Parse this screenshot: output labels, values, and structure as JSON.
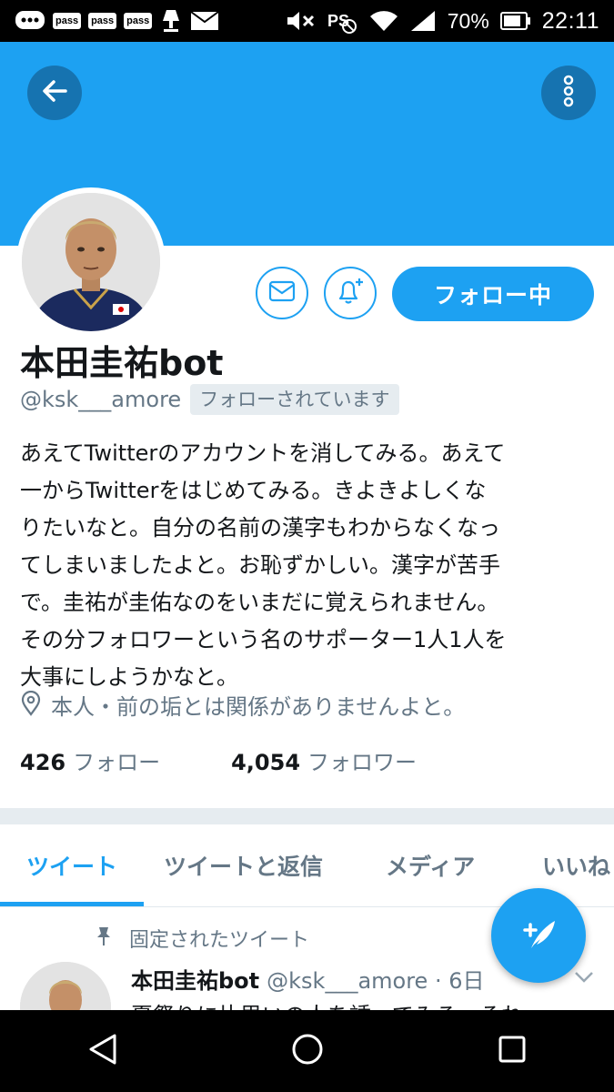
{
  "status_bar": {
    "pass_labels": [
      "pass",
      "pass",
      "pass"
    ],
    "battery": "70%",
    "time": "22:11"
  },
  "profile": {
    "name": "本田圭祐bot",
    "handle": "@ksk___amore",
    "follows_you": "フォローされています",
    "follow_button": "フォロー中",
    "bio": "あえてTwitterのアカウントを消してみる。あえて\n一からTwitterをはじめてみる。きよきよしくな\nりたいなと。自分の名前の漢字もわからなくなっ\nてしまいましたよと。お恥ずかしい。漢字が苦手\nで。圭祐が圭佑なのをいまだに覚えられません。\nその分フォロワーという名のサポーター1人1人を\n大事にしようかなと。",
    "location": "本人・前の垢とは関係がありませんよと。",
    "following_count": "426",
    "following_label": "フォロー",
    "followers_count": "4,054",
    "followers_label": "フォロワー"
  },
  "tabs": [
    {
      "label": "ツイート",
      "active": true
    },
    {
      "label": "ツイートと返信",
      "active": false
    },
    {
      "label": "メディア",
      "active": false
    },
    {
      "label": "いいね",
      "active": false
    }
  ],
  "pinned_tweet": {
    "pinned_label": "固定されたツイート",
    "name": "本田圭祐bot",
    "handle_time": "@ksk___amore · 6日",
    "text": "夏祭りに片思いの人を誘ってみる。それ"
  },
  "colors": {
    "accent": "#1da1f2",
    "secondary_text": "#657786"
  },
  "icons": {
    "back": "arrow-left-icon",
    "more": "more-vertical-icon",
    "message": "envelope-icon",
    "notify": "bell-plus-icon",
    "location": "location-pin-icon",
    "pin": "pin-icon",
    "compose": "feather-plus-icon"
  }
}
